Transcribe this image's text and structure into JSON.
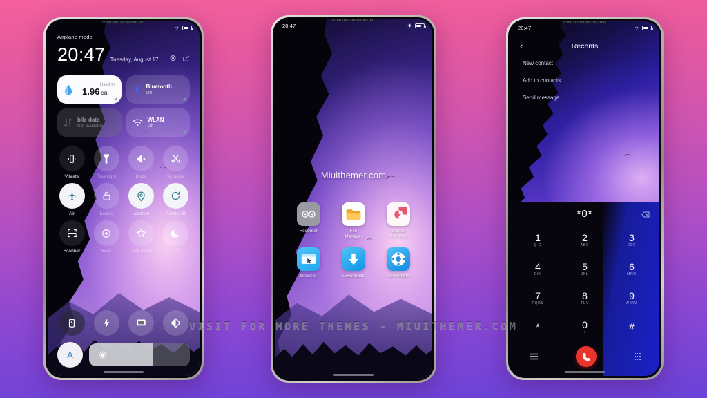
{
  "background": {
    "from": "#f4609c",
    "to": "#6a42d8"
  },
  "banner": {
    "text": "VISIT FOR MORE THEMES - MIUITHEMER.COM"
  },
  "phone1": {
    "statusbar": {
      "left": "Airplane mode",
      "plane_icon": "airplane-icon",
      "battery_icon": "battery-icon"
    },
    "clock": "20:47",
    "date": "Tuesday, August 17",
    "head_icons": [
      "settings-icon",
      "edit-icon"
    ],
    "data_tile": {
      "used_label": "Used th",
      "value": "1.96",
      "unit": "GB",
      "icon": "water-drop-icon"
    },
    "tiles": [
      {
        "name": "bluetooth",
        "title": "Bluetooth",
        "sub": "Off",
        "icon": "bluetooth-icon",
        "style": "glass"
      },
      {
        "name": "mobile-data",
        "title": "bile data",
        "sub": "Not available",
        "icon": "data-arrows-icon",
        "style": "dim"
      },
      {
        "name": "wlan",
        "title": "WLAN",
        "sub": "Off",
        "icon": "wifi-icon",
        "style": "glass"
      }
    ],
    "toggles": [
      {
        "label": "Vibrate",
        "icon": "vibrate-icon",
        "state": "dark"
      },
      {
        "label": "Flashlight",
        "icon": "flashlight-icon",
        "state": "off"
      },
      {
        "label": "Mute",
        "icon": "mute-icon",
        "state": "off"
      },
      {
        "label": "Screens",
        "icon": "screenshot-scissors-icon",
        "state": "off"
      },
      {
        "label": "Air",
        "icon": "airplane-mode-icon",
        "state": "on"
      },
      {
        "label": "Lock s",
        "icon": "lock-icon",
        "state": "off"
      },
      {
        "label": "Location",
        "icon": "location-pin-icon",
        "state": "on"
      },
      {
        "label": "Rotate off",
        "icon": "rotate-icon",
        "state": "on"
      },
      {
        "label": "Scanner",
        "icon": "scanner-icon",
        "state": "dark"
      },
      {
        "label": "Reac",
        "icon": "reading-mode-icon",
        "state": "off"
      },
      {
        "label": "Dark mode",
        "icon": "star-icon",
        "state": "off"
      },
      {
        "label": "DND",
        "icon": "moon-icon",
        "state": "off"
      }
    ],
    "bottom_row": [
      {
        "name": "battery-saver",
        "icon": "battery-saver-icon",
        "state": "dark"
      },
      {
        "name": "power-boost",
        "icon": "lightning-icon",
        "state": "off"
      },
      {
        "name": "cast",
        "icon": "cast-screen-icon",
        "state": "off"
      },
      {
        "name": "contrast",
        "icon": "contrast-icon",
        "state": "off"
      }
    ],
    "brightness": {
      "auto_label": "A",
      "sun_icon": "sun-icon",
      "level": 63
    }
  },
  "phone2": {
    "statusbar": {
      "time": "20:47",
      "plane_icon": "airplane-icon",
      "battery_icon": "battery-icon"
    },
    "wallpaper_text": "Miuithemer.com",
    "apps": [
      {
        "label": "Recorder",
        "icon": "recorder-icon"
      },
      {
        "label": "File\nManager",
        "icon": "folder-icon"
      },
      {
        "label": "Screen\nRecorder",
        "icon": "screen-recorder-icon"
      },
      {
        "label": "Browser",
        "icon": "browser-icon"
      },
      {
        "label": "Downloads",
        "icon": "download-icon"
      },
      {
        "label": "Mi Remote",
        "icon": "remote-icon"
      }
    ]
  },
  "phone3": {
    "statusbar": {
      "time": "20:47",
      "plane_icon": "airplane-icon",
      "battery_icon": "battery-icon"
    },
    "title": "Recents",
    "back_icon": "chevron-left-icon",
    "actions": [
      "New contact",
      "Add to contacts",
      "Send message"
    ],
    "dialed_number": "*0*",
    "backspace_icon": "backspace-icon",
    "keys": [
      {
        "num": "1",
        "letters": "Q D"
      },
      {
        "num": "2",
        "letters": "ABC"
      },
      {
        "num": "3",
        "letters": "DEF"
      },
      {
        "num": "4",
        "letters": "GHI"
      },
      {
        "num": "5",
        "letters": "JKL"
      },
      {
        "num": "6",
        "letters": "MNO"
      },
      {
        "num": "7",
        "letters": "PQRS"
      },
      {
        "num": "8",
        "letters": "TUV"
      },
      {
        "num": "9",
        "letters": "WXYZ"
      },
      {
        "num": "*",
        "letters": ""
      },
      {
        "num": "0",
        "letters": "+"
      },
      {
        "num": "#",
        "letters": ""
      }
    ],
    "footer": {
      "menu_icon": "menu-icon",
      "call_icon": "call-handset-icon",
      "dialpad_icon": "dialpad-icon"
    }
  }
}
